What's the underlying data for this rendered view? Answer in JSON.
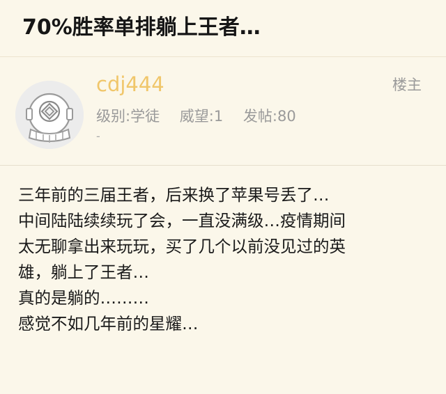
{
  "post": {
    "title": "70%胜率单排躺上王者…"
  },
  "author": {
    "username": "cdj444",
    "level": "级别:学徒",
    "reputation": "威望:1",
    "posts": "发帖:80",
    "extra": "-",
    "badge": "楼主",
    "avatar_icon": "diving-helmet-icon"
  },
  "content": {
    "lines": [
      "三年前的三届王者，后来换了苹果号丢了…",
      "中间陆陆续续玩了会，一直没满级…疫情期间",
      "太无聊拿出来玩玩，买了几个以前没见过的英",
      "雄，躺上了王者…",
      "真的是躺的………",
      "感觉不如几年前的星耀…"
    ]
  },
  "colors": {
    "background": "#fbf7ea",
    "username": "#f0c66a",
    "meta": "#9a9a9a"
  }
}
